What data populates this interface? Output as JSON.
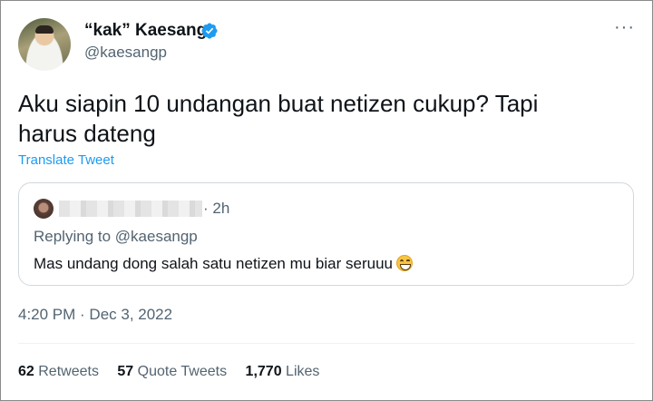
{
  "author": {
    "display_name": "“kak” Kaesang",
    "handle": "@kaesangp",
    "verified_icon": "verified-badge-icon",
    "verified_color": "#1d9bf0"
  },
  "more_label": "···",
  "tweet": {
    "text": "Aku siapin 10 undangan buat netizen cukup? Tapi harus dateng",
    "translate_label": "Translate Tweet"
  },
  "quoted_tweet": {
    "time": "· 2h",
    "replying_to": "Replying to @kaesangp",
    "text": "Mas undang dong salah satu netizen mu biar seruuu",
    "emoji": "grinning-squinting-face-emoji"
  },
  "timestamp": "4:20 PM · Dec 3, 2022",
  "stats": {
    "retweets_count": "62",
    "retweets_label": "Retweets",
    "quote_count": "57",
    "quote_label": "Quote Tweets",
    "likes_count": "1,770",
    "likes_label": "Likes"
  },
  "colors": {
    "link": "#1d9bf0",
    "muted": "#536471",
    "text": "#0f1419",
    "border": "#cfd9de"
  }
}
